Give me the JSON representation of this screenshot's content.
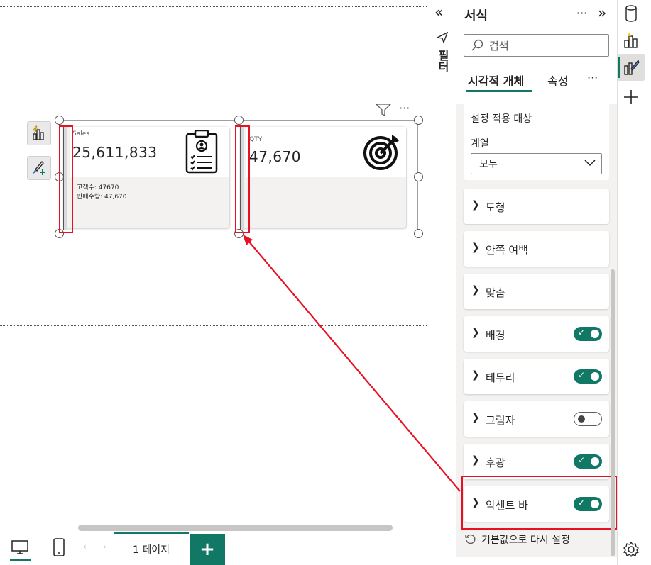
{
  "pane": {
    "title": "서식",
    "more_label": "···",
    "collapse_label": "»",
    "search_placeholder": "검색",
    "tabs": [
      {
        "label": "시각적 개체",
        "active": true
      },
      {
        "label": "속성",
        "active": false
      }
    ],
    "tabs_more": "···",
    "apply_to": {
      "heading": "설정 적용 대상",
      "series_label": "계열",
      "series_value": "모두"
    },
    "sections": [
      {
        "name": "도형",
        "toggle": null
      },
      {
        "name": "안쪽 여백",
        "toggle": null
      },
      {
        "name": "맞춤",
        "toggle": null
      },
      {
        "name": "배경",
        "toggle": "on"
      },
      {
        "name": "테두리",
        "toggle": "on"
      },
      {
        "name": "그림자",
        "toggle": "off"
      },
      {
        "name": "후광",
        "toggle": "on"
      },
      {
        "name": "악센트 바",
        "toggle": "on"
      }
    ],
    "reset_label": "기본값으로 다시 설정"
  },
  "filter_strip": {
    "expand_label": "«",
    "label": "필터"
  },
  "cards": [
    {
      "label": "Sales",
      "value": "25,611,833",
      "details": [
        "고객수: 47670",
        "판매수량: 47,670"
      ],
      "icon": "clipboard-user-icon"
    },
    {
      "label": "QTY",
      "value": "47,670",
      "details": [],
      "icon": "target-arrow-icon"
    }
  ],
  "bottom": {
    "page_tab": "1 페이지",
    "add_label": "+"
  },
  "colors": {
    "accent": "#117865",
    "highlight": "#e81123"
  }
}
